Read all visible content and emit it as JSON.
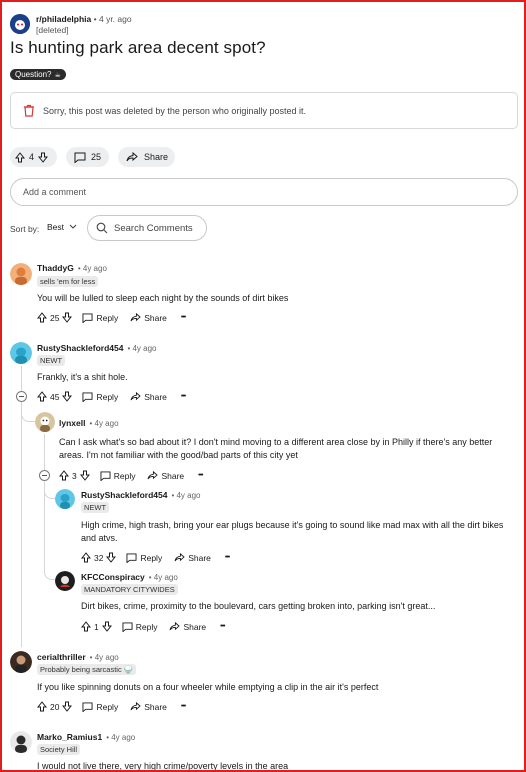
{
  "post": {
    "subreddit": "r/philadelphia",
    "age": "• 4 yr. ago",
    "author": "[deleted]",
    "title": "Is hunting park area decent spot?",
    "flair": "Question?",
    "deleted_notice": "Sorry, this post was deleted by the person who originally posted it.",
    "score": "4",
    "comment_count": "25",
    "share_label": "Share"
  },
  "comment_box": {
    "placeholder": "Add a comment"
  },
  "sort": {
    "label": "Sort by:",
    "value": "Best",
    "search_placeholder": "Search Comments"
  },
  "labels": {
    "reply": "Reply",
    "share": "Share",
    "more": "•••"
  },
  "comments": [
    {
      "author": "ThaddyG",
      "age": "• 4y ago",
      "flair": "sells 'em for less",
      "body": "You will be lulled to sleep each night by the sounds of dirt bikes",
      "score": "25"
    },
    {
      "author": "RustyShackleford454",
      "age": "• 4y ago",
      "flair": "NEWT",
      "body": "Frankly, it's a shit hole.",
      "score": "45"
    },
    {
      "author": "lynxell",
      "age": "• 4y ago",
      "flair": "",
      "body": "Can I ask what's so bad about it? I don't mind moving to a different area close by in Philly if there's any better areas. I'm not familiar with the good/bad parts of this city yet",
      "score": "3"
    },
    {
      "author": "RustyShackleford454",
      "age": "• 4y ago",
      "flair": "NEWT",
      "body": "High crime, high trash, bring your ear plugs because it's going to sound like mad max with all the dirt bikes and atvs.",
      "score": "32"
    },
    {
      "author": "KFCConspiracy",
      "age": "• 4y ago",
      "flair": "MANDATORY CITYWIDES",
      "body": "Dirt bikes, crime, proximity to the boulevard, cars getting broken into, parking isn't great...",
      "score": "1"
    },
    {
      "author": "cerialthriller",
      "age": "• 4y ago",
      "flair": "Probably being sarcastic 🍚",
      "body": "If you like spinning donuts on a four wheeler while emptying a clip in the air it's perfect",
      "score": "20"
    },
    {
      "author": "Marko_Ramius1",
      "age": "• 4y ago",
      "flair": "Society Hill",
      "body": "I would not live there, very high crime/poverty levels in the area",
      "score": ""
    }
  ],
  "colors": {
    "frame": "#e11d1d",
    "pill": "#eceef0",
    "deleted_icon": "#d93a3a"
  }
}
